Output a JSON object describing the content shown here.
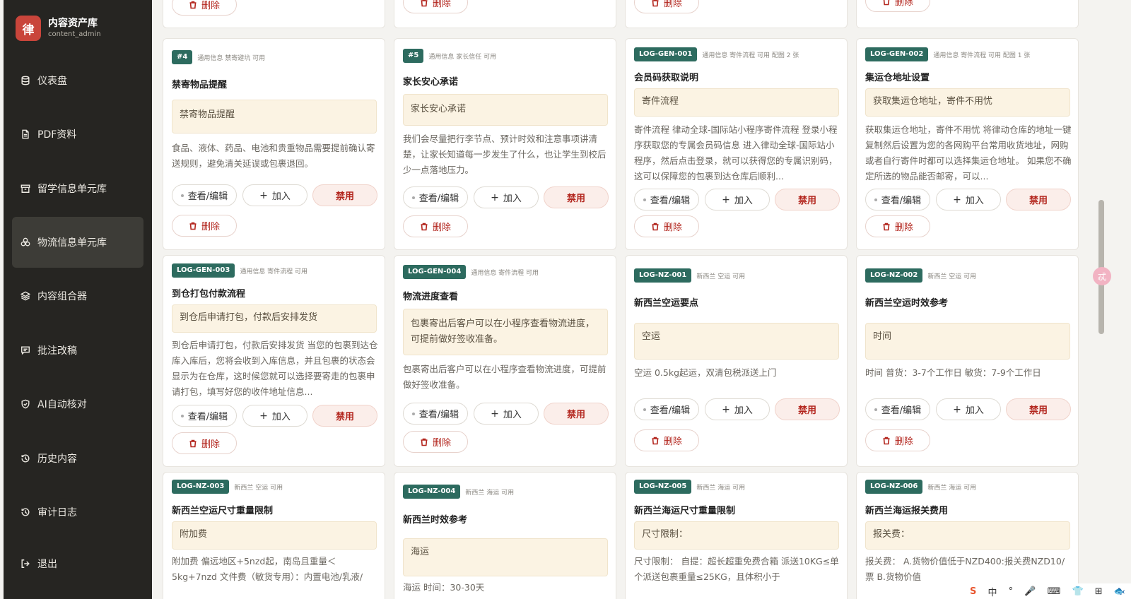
{
  "brand": {
    "logo": "律",
    "title": "内容资产库",
    "subtitle": "content_admin"
  },
  "nav": [
    {
      "label": "仪表盘",
      "icon": "database-icon"
    },
    {
      "label": "PDF资料",
      "icon": "file-icon"
    },
    {
      "label": "留学信息单元库",
      "icon": "archive-icon"
    },
    {
      "label": "物流信息单元库",
      "icon": "boxes-icon",
      "active": true
    },
    {
      "label": "内容组合器",
      "icon": "layers-icon"
    },
    {
      "label": "批注改稿",
      "icon": "comment-icon"
    },
    {
      "label": "AI自动核对",
      "icon": "shield-check-icon"
    },
    {
      "label": "历史内容",
      "icon": "history-icon"
    },
    {
      "label": "审计日志",
      "icon": "history-icon"
    },
    {
      "label": "退出",
      "icon": "logout-icon"
    }
  ],
  "actions": {
    "view": "查看/编辑",
    "add": "加入",
    "ban": "禁用",
    "delete": "删除"
  },
  "cards": [
    {
      "tag": "#4",
      "meta": "通用信息  禁寄避坑  可用",
      "title": "禁寄物品提醒",
      "highlight": "禁寄物品提醒",
      "desc": "食品、液体、药品、电池和贵重物品需要提前确认寄送规则，避免清关延误或包裹退回。"
    },
    {
      "tag": "#5",
      "meta": "通用信息  家长信任  可用",
      "title": "家长安心承诺",
      "highlight": "家长安心承诺",
      "desc": "我们会尽量把行李节点、预计时效和注意事项讲清楚，让家长知道每一步发生了什么，也让学生到校后少一点落地压力。"
    },
    {
      "tag": "LOG-GEN-001",
      "meta": "通用信息  寄件流程  可用  配图 2 张",
      "title": "会员码获取说明",
      "highlight": "寄件流程",
      "desc": "寄件流程 律动全球-国际站小程序寄件流程 登录小程序获取您的专属会员码信息 进入律动全球-国际站小程序，然后点击登录，就可以获得您的专属识别码，这可以保障您的包裹到达仓库后顺利..."
    },
    {
      "tag": "LOG-GEN-002",
      "meta": "通用信息  寄件流程  可用  配图 1 张",
      "title": "集运仓地址设置",
      "highlight": "获取集运仓地址，寄件不用忧",
      "desc": "获取集运仓地址，寄件不用忧 将律动仓库的地址一键复制然后设置为您的各网购平台常用收货地址，网购或者自行寄件时都可以选择集运仓地址。 如果您不确定所选的物品能否邮寄，可以..."
    },
    {
      "tag": "LOG-GEN-003",
      "meta": "通用信息  寄件流程  可用",
      "title": "到仓打包付款流程",
      "highlight": "到仓后申请打包，付款后安排发货",
      "desc": "到仓后申请打包，付款后安排发货 当您的包裹到达仓库入库后，您将会收到入库信息，并且包裹的状态会显示为在仓库，这时候您就可以选择要寄走的包裹申请打包，填写好您的收件地址信息..."
    },
    {
      "tag": "LOG-GEN-004",
      "meta": "通用信息  寄件流程  可用",
      "title": "物流进度查看",
      "highlight": "包裹寄出后客户可以在小程序查看物流进度，可提前做好签收准备。",
      "desc": "包裹寄出后客户可以在小程序查看物流进度，可提前做好签收准备。"
    },
    {
      "tag": "LOG-NZ-001",
      "meta": "新西兰  空运  可用",
      "title": "新西兰空运要点",
      "highlight": "空运",
      "desc": "空运 0.5kg起运，双清包税派送上门"
    },
    {
      "tag": "LOG-NZ-002",
      "meta": "新西兰  空运  可用",
      "title": "新西兰空运时效参考",
      "highlight": "时间",
      "desc": "时间 普货：3-7个工作日 敏货：7-9个工作日"
    },
    {
      "tag": "LOG-NZ-003",
      "meta": "新西兰  空运  可用",
      "title": "新西兰空运尺寸重量限制",
      "highlight": "附加费",
      "desc": "附加费 偏远地区+5nzd起，南岛且重量＜5kg+7nzd 文件费（敏货专用）：内置电池/乳液/"
    },
    {
      "tag": "LOG-NZ-004",
      "meta": "新西兰  海运  可用",
      "title": "新西兰时效参考",
      "highlight": "海运",
      "desc": "海运 时间：30-30天"
    },
    {
      "tag": "LOG-NZ-005",
      "meta": "新西兰  海运  可用",
      "title": "新西兰海运尺寸重量限制",
      "highlight": "尺寸限制：",
      "desc": "尺寸限制： 自提：超长超重免费合箱 派送10KG≤单个派送包裹重量≤25KG，且体积小于"
    },
    {
      "tag": "LOG-NZ-006",
      "meta": "新西兰  海运  可用",
      "title": "新西兰海运报关费用",
      "highlight": "报关费：",
      "desc": "报关费： A.货物价值低于NZD400:报关费NZD10/票 B.货物价值"
    }
  ],
  "float_icon": "忒",
  "ime": [
    "S",
    "中",
    "°",
    "🎤",
    "⌨",
    "👕",
    "⊞",
    "🐟"
  ]
}
